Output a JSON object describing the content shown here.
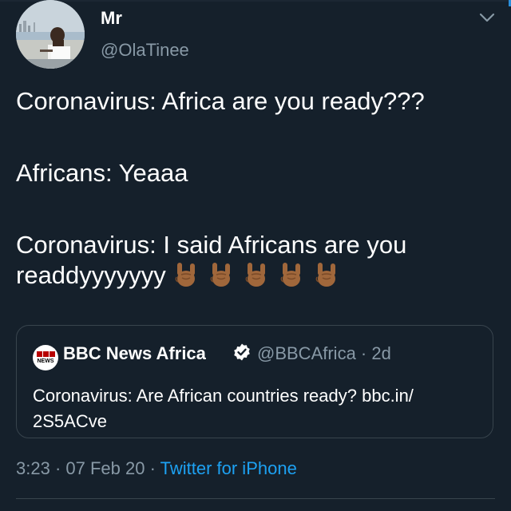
{
  "user": {
    "name": "Mr",
    "handle": "@OlaTinee"
  },
  "tweet": {
    "line1": "Coronavirus: Africa are you ready???",
    "line2": "Africans: Yeaaa",
    "line3": "Coronavirus: I said Africans are you",
    "line4": "readdyyyyyyy",
    "emoji_count": 5,
    "emoji_icon": "sign-of-horns-medium-dark-skin"
  },
  "quote": {
    "logo_top": "BBC",
    "logo_bottom": "NEWS",
    "name": "BBC News Africa",
    "handle": "@BBCAfrica",
    "time": "2d",
    "text": "Coronavirus: Are African countries ready? bbc.in/ 2S5ACve"
  },
  "footer": {
    "time": "3:23",
    "date": "07 Feb 20",
    "source": "Twitter for iPhone"
  },
  "colors": {
    "background": "#15202b",
    "secondary_text": "#8899a6",
    "link": "#1da1f2",
    "border": "#38444d",
    "verified": "#ffffff",
    "emoji_skin": "#a0673b"
  }
}
